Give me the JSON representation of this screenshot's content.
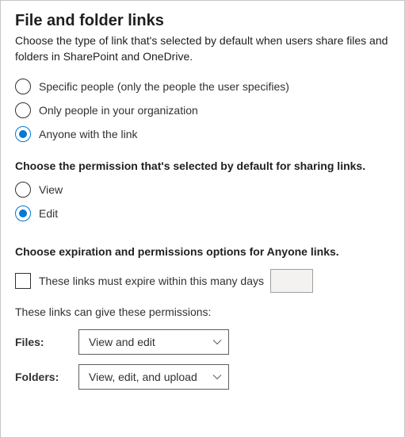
{
  "title": "File and folder links",
  "description": "Choose the type of link that's selected by default when users share files and folders in SharePoint and OneDrive.",
  "linkType": {
    "options": [
      {
        "label": "Specific people (only the people the user specifies)",
        "selected": false
      },
      {
        "label": "Only people in your organization",
        "selected": false
      },
      {
        "label": "Anyone with the link",
        "selected": true
      }
    ]
  },
  "permissionSection": {
    "heading": "Choose the permission that's selected by default for sharing links.",
    "options": [
      {
        "label": "View",
        "selected": false
      },
      {
        "label": "Edit",
        "selected": true
      }
    ]
  },
  "anyoneSection": {
    "heading": "Choose expiration and permissions options for Anyone links.",
    "expireLabel": "These links must expire within this many days",
    "expireChecked": false,
    "expireDays": "",
    "permText": "These links can give these permissions:",
    "filesLabel": "Files:",
    "filesValue": "View and edit",
    "foldersLabel": "Folders:",
    "foldersValue": "View, edit, and upload"
  }
}
